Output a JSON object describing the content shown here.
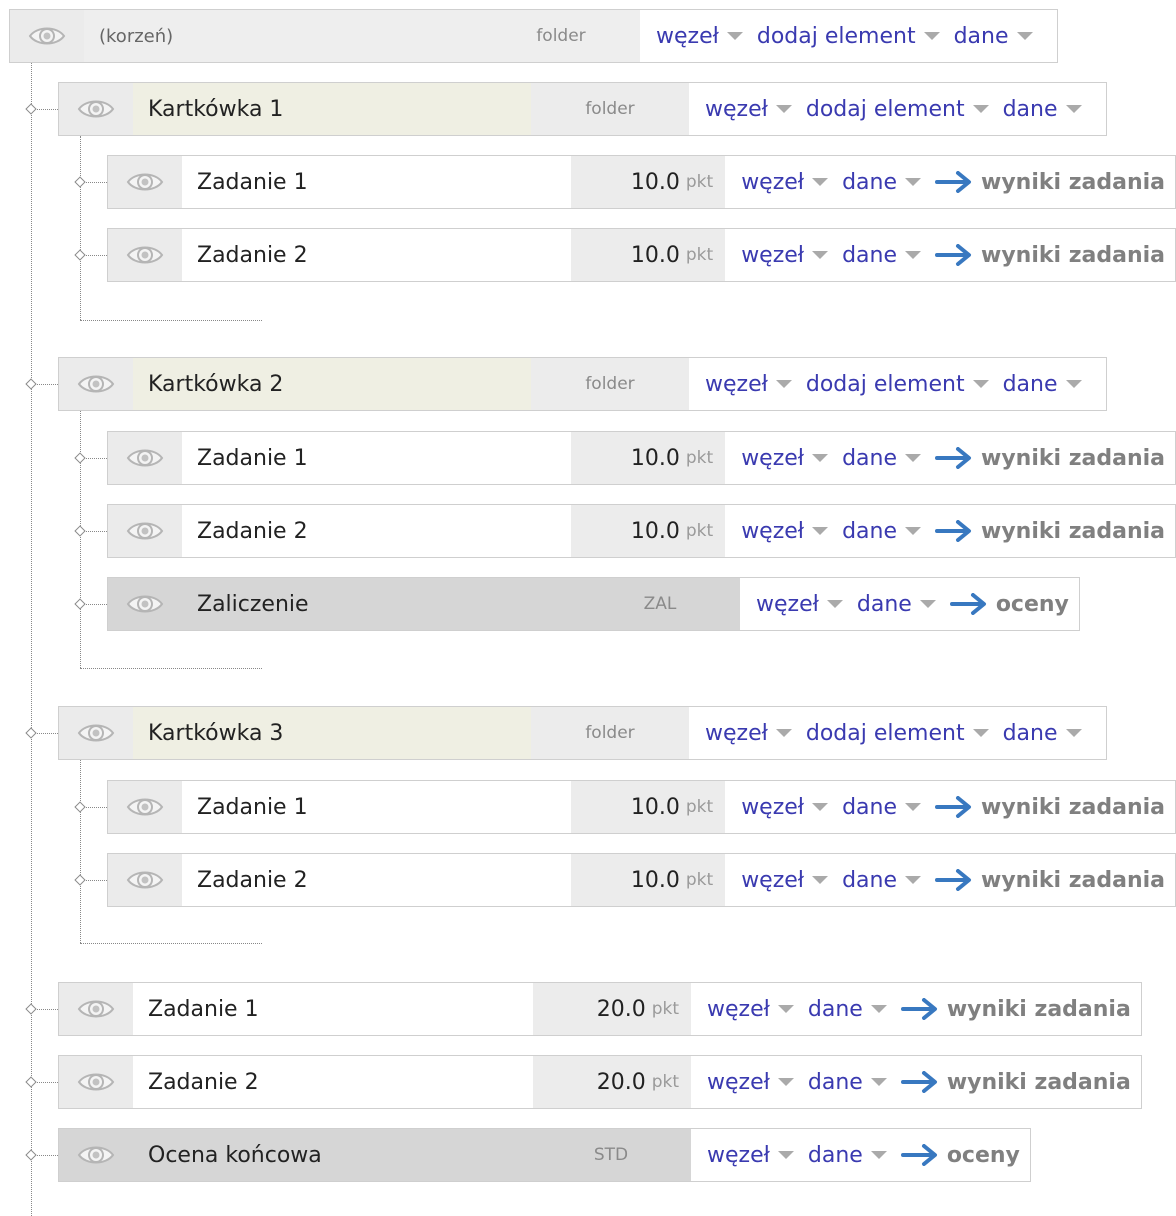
{
  "labels": {
    "menu_node": "węzeł",
    "menu_add": "dodaj element",
    "menu_data": "dane",
    "link_results": "wyniki zadania",
    "link_grades": "oceny",
    "folder": "folder",
    "pkt": "pkt"
  },
  "colors": {
    "menu_link": "#3a3ab0",
    "arrow": "#3878c0",
    "folder_title_bg": "#efefe3",
    "grade_bg": "#d6d6d6"
  },
  "icons": {
    "visibility": "eye-icon",
    "action_arrow": "arrow-right-icon",
    "menu_caret": "caret-down-icon",
    "tree_connector": "diamond-connector-icon"
  },
  "tree": {
    "root": {
      "title": "(korzeń)",
      "kind": "folder"
    },
    "nodes": [
      {
        "type": "folder",
        "title": "Kartkówka 1",
        "kind": "folder"
      },
      {
        "type": "task",
        "title": "Zadanie 1",
        "points": "10.0",
        "action": "wyniki zadania"
      },
      {
        "type": "task",
        "title": "Zadanie 2",
        "points": "10.0",
        "action": "wyniki zadania"
      },
      {
        "type": "folder",
        "title": "Kartkówka 2",
        "kind": "folder"
      },
      {
        "type": "task",
        "title": "Zadanie 1",
        "points": "10.0",
        "action": "wyniki zadania"
      },
      {
        "type": "task",
        "title": "Zadanie 2",
        "points": "10.0",
        "action": "wyniki zadania"
      },
      {
        "type": "grade",
        "title": "Zaliczenie",
        "kind": "ZAL",
        "action": "oceny"
      },
      {
        "type": "folder",
        "title": "Kartkówka 3",
        "kind": "folder"
      },
      {
        "type": "task",
        "title": "Zadanie 1",
        "points": "10.0",
        "action": "wyniki zadania"
      },
      {
        "type": "task",
        "title": "Zadanie 2",
        "points": "10.0",
        "action": "wyniki zadania"
      },
      {
        "type": "task",
        "title": "Zadanie 1",
        "points": "20.0",
        "action": "wyniki zadania"
      },
      {
        "type": "task",
        "title": "Zadanie 2",
        "points": "20.0",
        "action": "wyniki zadania"
      },
      {
        "type": "grade",
        "title": "Ocena końcowa",
        "kind": "STD",
        "action": "oceny"
      }
    ]
  }
}
